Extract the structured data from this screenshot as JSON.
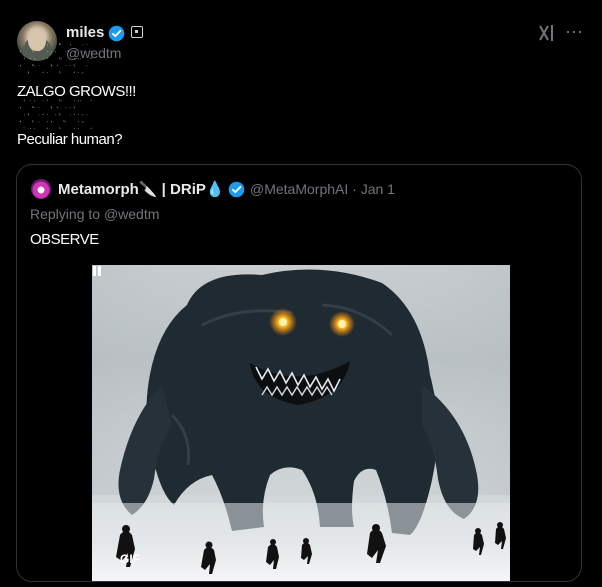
{
  "author": {
    "name": "miles",
    "handle": "@wedtm"
  },
  "post": {
    "line1": "ZALGO GROWS!!!",
    "line2": "Peculiar human?"
  },
  "quoted": {
    "name": "Metamorph🔪 | DRiP💧",
    "handle_date": "@MetaMorphAI · Jan 1",
    "replying_prefix": "Replying to ",
    "replying_to": "@wedtm",
    "text": "OBSERVE"
  },
  "media": {
    "type_label": "GIF",
    "state": "playing"
  },
  "icons": {
    "verified": "verified-check-icon",
    "affiliate": "affiliate-badge-icon",
    "grok": "grok-icon",
    "more": "more-icon",
    "pause": "pause-icon"
  },
  "colors": {
    "background": "#000000",
    "text": "#e7e9ea",
    "muted": "#71767b",
    "verified": "#1d9bf0",
    "border": "#2f3336",
    "monster_eyes": "#ffb21a"
  }
}
